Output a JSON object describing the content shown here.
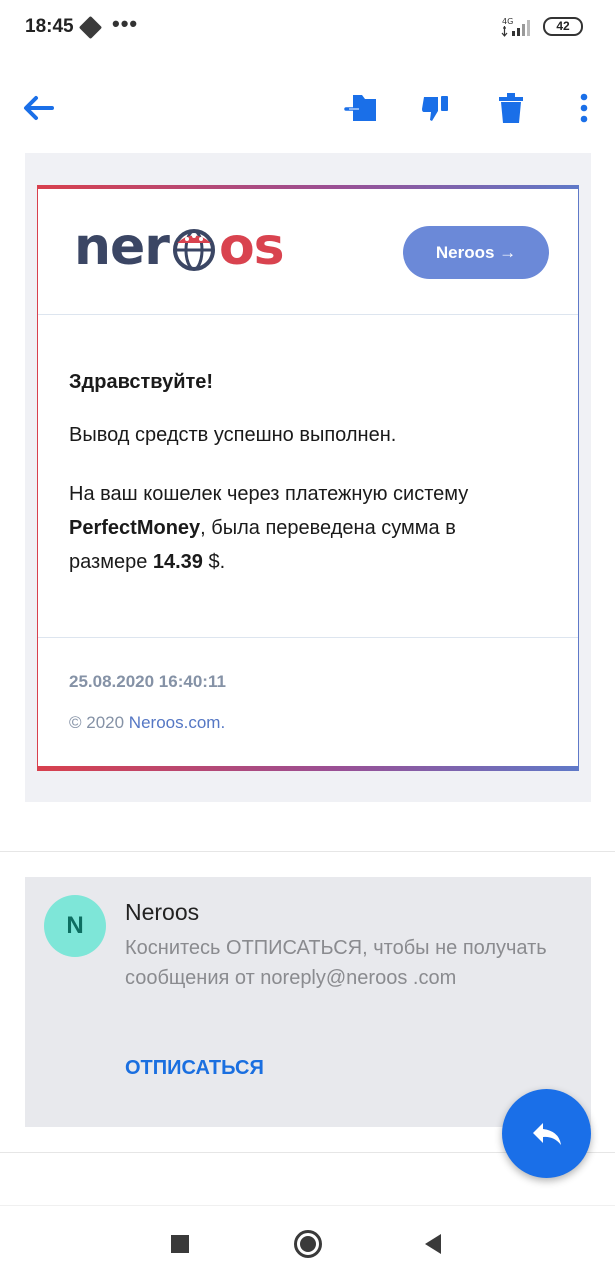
{
  "status_bar": {
    "time": "18:45",
    "dots": "•••",
    "network": "4G",
    "battery": "42"
  },
  "colors": {
    "accent": "#1a6fe8",
    "logo_dark": "#3b4664",
    "logo_red": "#d9434f",
    "button_blue": "#6b89d8",
    "avatar_bg": "#7ee6d8"
  },
  "toolbar": {
    "icons": [
      "back-arrow-icon",
      "move-to-folder-icon",
      "spam-icon",
      "delete-icon",
      "more-vert-icon"
    ]
  },
  "email": {
    "logo_left": "ner",
    "logo_right": "os",
    "header_button": "Neroos →",
    "greeting": "Здравствуйте!",
    "line1": "Вывод средств успешно выполнен.",
    "line2_part1": "На ваш кошелек через платежную систему ",
    "line2_system": "PerfectMoney",
    "line2_part2": ", была переведена сумма в размере ",
    "line2_amount": "14.39",
    "line2_currency": " $.",
    "footer_date": "25.08.2020 16:40:11",
    "footer_copy_prefix": "© 2020 ",
    "footer_copy_link": "Neroos.com."
  },
  "unsubscribe": {
    "avatar_letter": "N",
    "sender": "Neroos",
    "text": "Коснитесь ОТПИСАТЬСЯ, чтобы не получать сообщения от noreply@neroos .com",
    "button": "ОТПИСАТЬСЯ"
  },
  "fab": {
    "icon": "reply-icon"
  },
  "navbar": {
    "icons": [
      "recents-square-icon",
      "home-circle-icon",
      "back-triangle-icon"
    ]
  }
}
